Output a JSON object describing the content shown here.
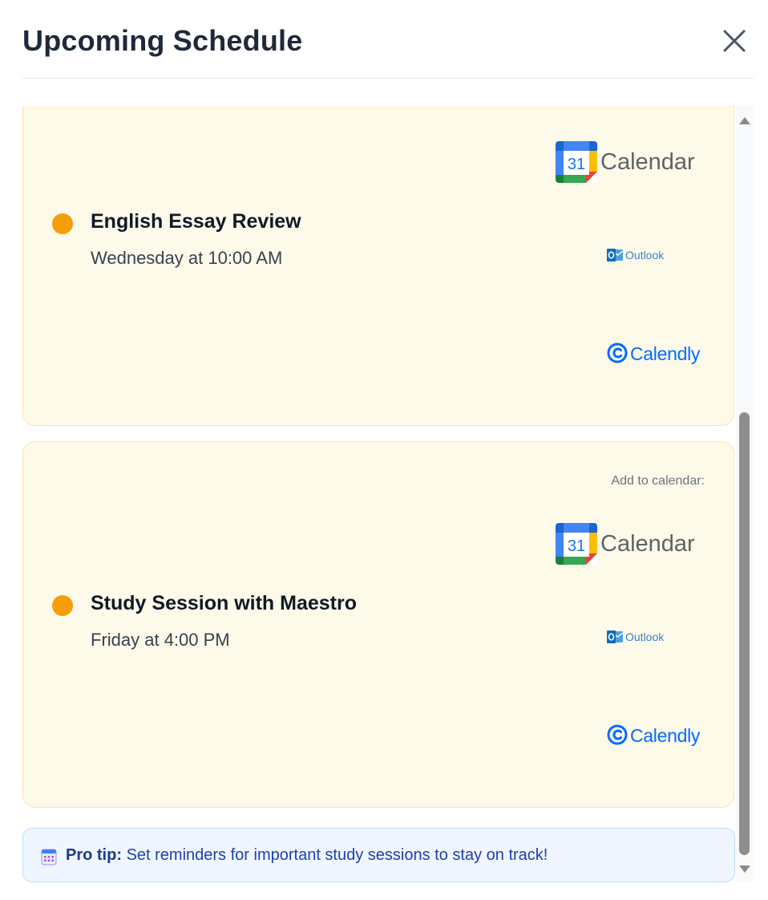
{
  "header": {
    "title": "Upcoming Schedule",
    "close_icon": "close-icon"
  },
  "add_to_calendar_label": "Add to calendar:",
  "providers": {
    "google": "Calendar",
    "google_badge": "31",
    "outlook": "Outlook",
    "calendly": "Calendly"
  },
  "events": [
    {
      "title": "English Essay Review",
      "time": "Wednesday at 10:00 AM",
      "dot_color": "#f59e0b"
    },
    {
      "title": "Study Session with Maestro",
      "time": "Friday at 4:00 PM",
      "dot_color": "#f59e0b"
    }
  ],
  "tip": {
    "icon": "calendar-icon",
    "label": "Pro tip:",
    "text": "Set reminders for important study sessions to stay on track!"
  },
  "colors": {
    "card_bg": "#fefaea",
    "card_border": "#fbe6a0",
    "tip_bg": "#eff6ff",
    "tip_text": "#1e40af"
  }
}
